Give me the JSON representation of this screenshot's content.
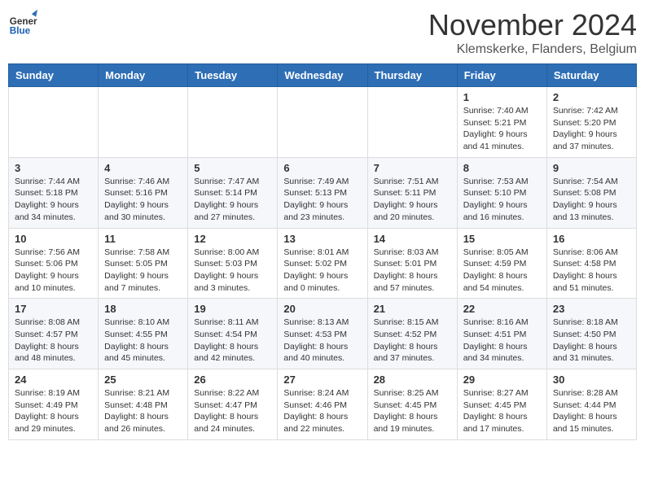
{
  "logo": {
    "general": "General",
    "blue": "Blue"
  },
  "header": {
    "month_year": "November 2024",
    "location": "Klemskerke, Flanders, Belgium"
  },
  "days_of_week": [
    "Sunday",
    "Monday",
    "Tuesday",
    "Wednesday",
    "Thursday",
    "Friday",
    "Saturday"
  ],
  "weeks": [
    [
      {
        "day": "",
        "info": ""
      },
      {
        "day": "",
        "info": ""
      },
      {
        "day": "",
        "info": ""
      },
      {
        "day": "",
        "info": ""
      },
      {
        "day": "",
        "info": ""
      },
      {
        "day": "1",
        "info": "Sunrise: 7:40 AM\nSunset: 5:21 PM\nDaylight: 9 hours and 41 minutes."
      },
      {
        "day": "2",
        "info": "Sunrise: 7:42 AM\nSunset: 5:20 PM\nDaylight: 9 hours and 37 minutes."
      }
    ],
    [
      {
        "day": "3",
        "info": "Sunrise: 7:44 AM\nSunset: 5:18 PM\nDaylight: 9 hours and 34 minutes."
      },
      {
        "day": "4",
        "info": "Sunrise: 7:46 AM\nSunset: 5:16 PM\nDaylight: 9 hours and 30 minutes."
      },
      {
        "day": "5",
        "info": "Sunrise: 7:47 AM\nSunset: 5:14 PM\nDaylight: 9 hours and 27 minutes."
      },
      {
        "day": "6",
        "info": "Sunrise: 7:49 AM\nSunset: 5:13 PM\nDaylight: 9 hours and 23 minutes."
      },
      {
        "day": "7",
        "info": "Sunrise: 7:51 AM\nSunset: 5:11 PM\nDaylight: 9 hours and 20 minutes."
      },
      {
        "day": "8",
        "info": "Sunrise: 7:53 AM\nSunset: 5:10 PM\nDaylight: 9 hours and 16 minutes."
      },
      {
        "day": "9",
        "info": "Sunrise: 7:54 AM\nSunset: 5:08 PM\nDaylight: 9 hours and 13 minutes."
      }
    ],
    [
      {
        "day": "10",
        "info": "Sunrise: 7:56 AM\nSunset: 5:06 PM\nDaylight: 9 hours and 10 minutes."
      },
      {
        "day": "11",
        "info": "Sunrise: 7:58 AM\nSunset: 5:05 PM\nDaylight: 9 hours and 7 minutes."
      },
      {
        "day": "12",
        "info": "Sunrise: 8:00 AM\nSunset: 5:03 PM\nDaylight: 9 hours and 3 minutes."
      },
      {
        "day": "13",
        "info": "Sunrise: 8:01 AM\nSunset: 5:02 PM\nDaylight: 9 hours and 0 minutes."
      },
      {
        "day": "14",
        "info": "Sunrise: 8:03 AM\nSunset: 5:01 PM\nDaylight: 8 hours and 57 minutes."
      },
      {
        "day": "15",
        "info": "Sunrise: 8:05 AM\nSunset: 4:59 PM\nDaylight: 8 hours and 54 minutes."
      },
      {
        "day": "16",
        "info": "Sunrise: 8:06 AM\nSunset: 4:58 PM\nDaylight: 8 hours and 51 minutes."
      }
    ],
    [
      {
        "day": "17",
        "info": "Sunrise: 8:08 AM\nSunset: 4:57 PM\nDaylight: 8 hours and 48 minutes."
      },
      {
        "day": "18",
        "info": "Sunrise: 8:10 AM\nSunset: 4:55 PM\nDaylight: 8 hours and 45 minutes."
      },
      {
        "day": "19",
        "info": "Sunrise: 8:11 AM\nSunset: 4:54 PM\nDaylight: 8 hours and 42 minutes."
      },
      {
        "day": "20",
        "info": "Sunrise: 8:13 AM\nSunset: 4:53 PM\nDaylight: 8 hours and 40 minutes."
      },
      {
        "day": "21",
        "info": "Sunrise: 8:15 AM\nSunset: 4:52 PM\nDaylight: 8 hours and 37 minutes."
      },
      {
        "day": "22",
        "info": "Sunrise: 8:16 AM\nSunset: 4:51 PM\nDaylight: 8 hours and 34 minutes."
      },
      {
        "day": "23",
        "info": "Sunrise: 8:18 AM\nSunset: 4:50 PM\nDaylight: 8 hours and 31 minutes."
      }
    ],
    [
      {
        "day": "24",
        "info": "Sunrise: 8:19 AM\nSunset: 4:49 PM\nDaylight: 8 hours and 29 minutes."
      },
      {
        "day": "25",
        "info": "Sunrise: 8:21 AM\nSunset: 4:48 PM\nDaylight: 8 hours and 26 minutes."
      },
      {
        "day": "26",
        "info": "Sunrise: 8:22 AM\nSunset: 4:47 PM\nDaylight: 8 hours and 24 minutes."
      },
      {
        "day": "27",
        "info": "Sunrise: 8:24 AM\nSunset: 4:46 PM\nDaylight: 8 hours and 22 minutes."
      },
      {
        "day": "28",
        "info": "Sunrise: 8:25 AM\nSunset: 4:45 PM\nDaylight: 8 hours and 19 minutes."
      },
      {
        "day": "29",
        "info": "Sunrise: 8:27 AM\nSunset: 4:45 PM\nDaylight: 8 hours and 17 minutes."
      },
      {
        "day": "30",
        "info": "Sunrise: 8:28 AM\nSunset: 4:44 PM\nDaylight: 8 hours and 15 minutes."
      }
    ]
  ]
}
